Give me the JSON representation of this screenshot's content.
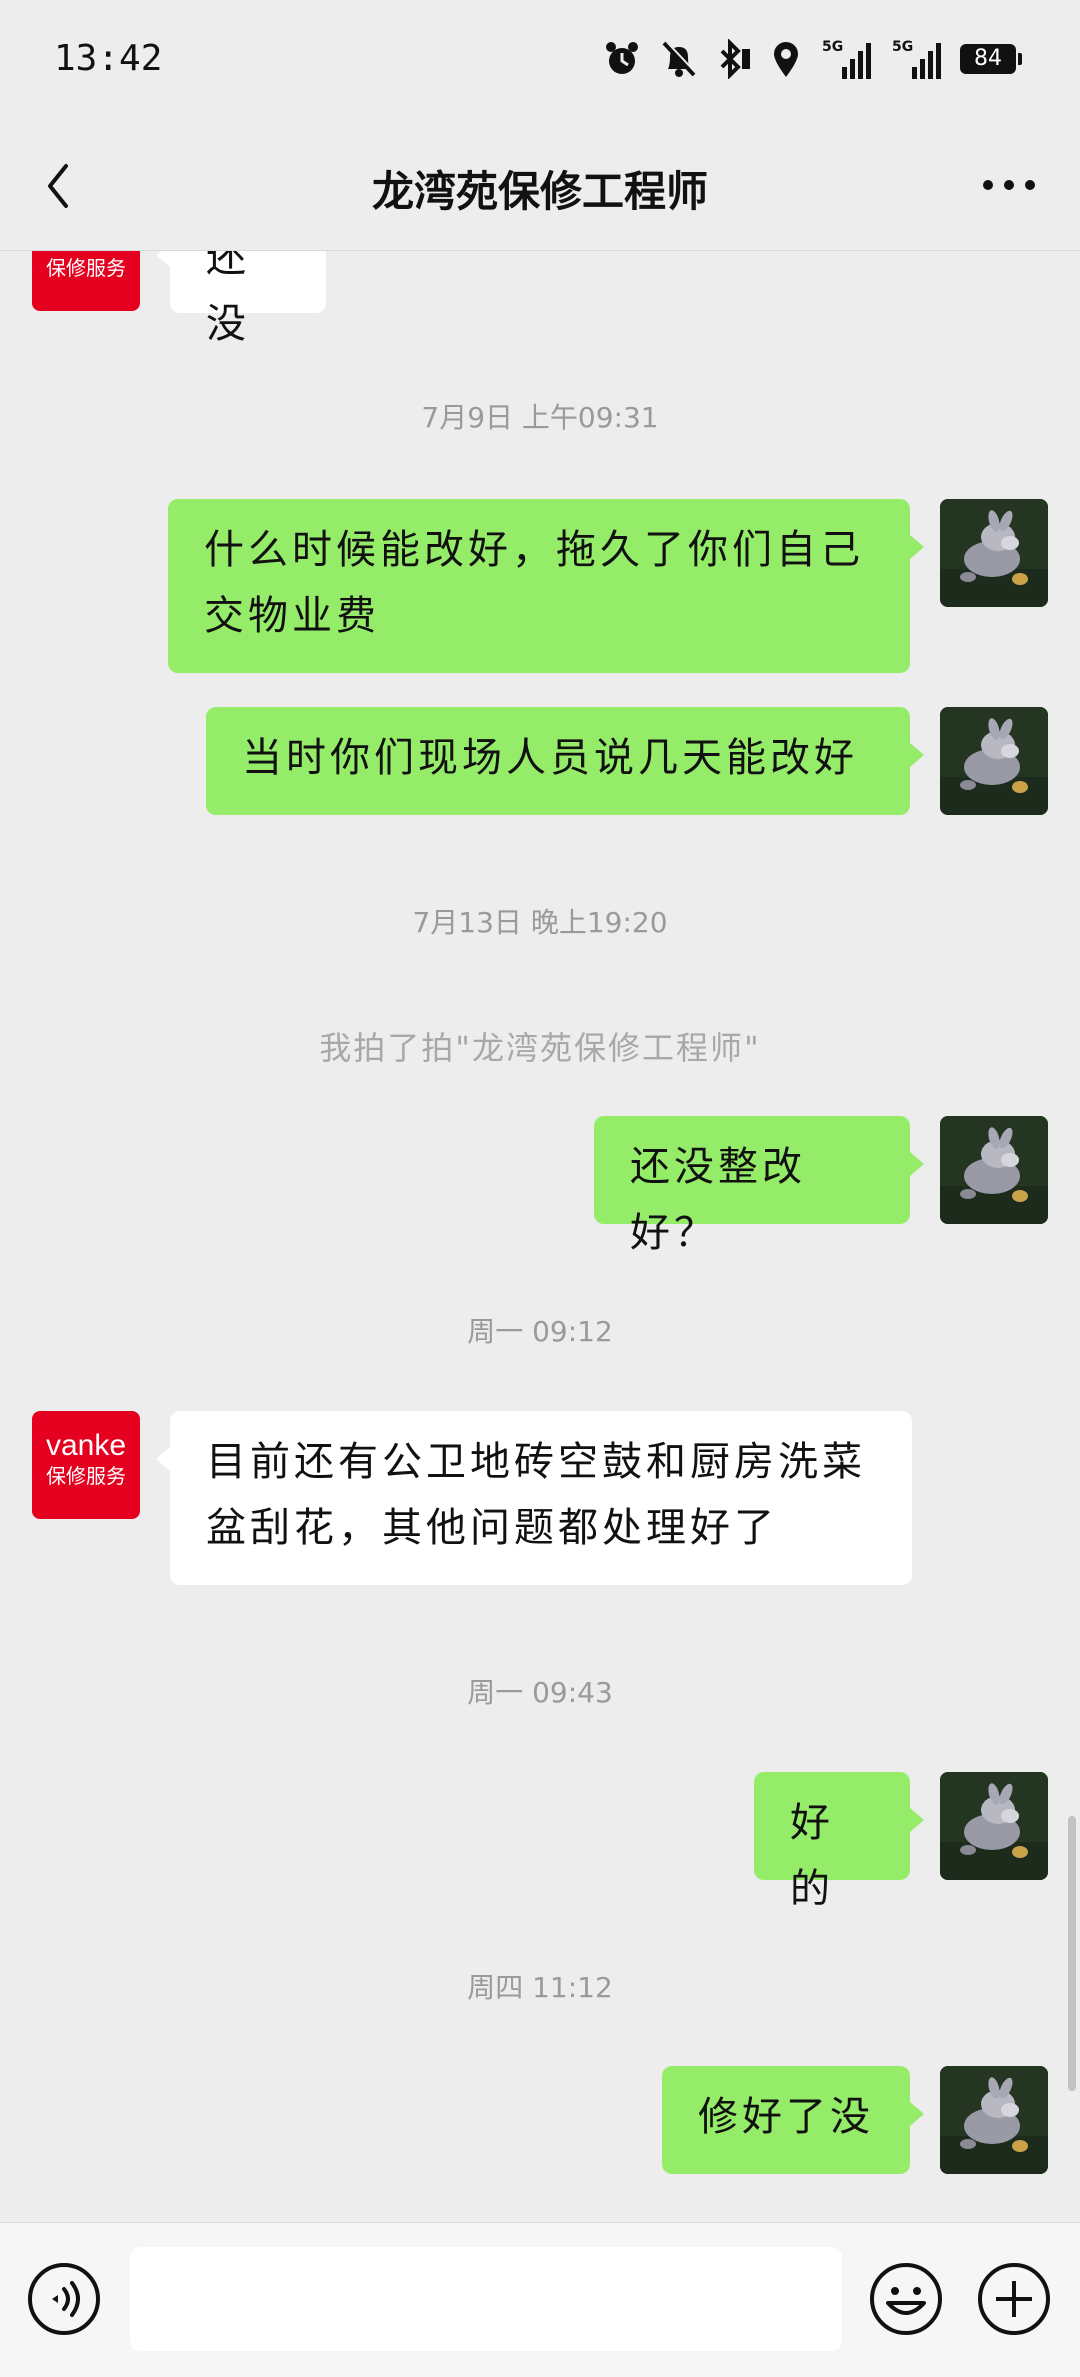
{
  "status_bar": {
    "time": "13:42",
    "network_1": "5G",
    "network_2": "5G",
    "battery": "84",
    "icons": [
      "alarm-icon",
      "mute-bell-icon",
      "bluetooth-icon",
      "location-icon",
      "signal-5g-icon",
      "signal-5g-icon",
      "battery-icon"
    ]
  },
  "header": {
    "title": "龙湾苑保修工程师",
    "back_icon": "chevron-left-icon",
    "more_icon": "more-dots-icon"
  },
  "contact": {
    "avatar_line1": "vanke",
    "avatar_line2": "保修服务",
    "avatar_color": "#e6001f"
  },
  "colors": {
    "my_bubble": "#95ec69",
    "other_bubble": "#ffffff",
    "background": "#ededed"
  },
  "messages": [
    {
      "type": "text",
      "from": "other",
      "text": "还没"
    },
    {
      "type": "time",
      "text": "7月9日 上午09:31"
    },
    {
      "type": "text",
      "from": "me",
      "text": "什么时候能改好，拖久了你们自己交物业费"
    },
    {
      "type": "text",
      "from": "me",
      "text": "当时你们现场人员说几天能改好"
    },
    {
      "type": "time",
      "text": "7月13日 晚上19:20"
    },
    {
      "type": "system",
      "text": "我拍了拍\"龙湾苑保修工程师\""
    },
    {
      "type": "text",
      "from": "me",
      "text": "还没整改好？"
    },
    {
      "type": "time",
      "text": "周一 09:12"
    },
    {
      "type": "text",
      "from": "other",
      "text": "目前还有公卫地砖空鼓和厨房洗菜盆刮花，其他问题都处理好了"
    },
    {
      "type": "time",
      "text": "周一 09:43"
    },
    {
      "type": "text",
      "from": "me",
      "text": "好的"
    },
    {
      "type": "time",
      "text": "周四 11:12"
    },
    {
      "type": "text",
      "from": "me",
      "text": "修好了没"
    }
  ],
  "input_bar": {
    "voice_icon": "voice-icon",
    "input_value": "",
    "emoji_icon": "emoji-icon",
    "plus_icon": "plus-icon"
  }
}
